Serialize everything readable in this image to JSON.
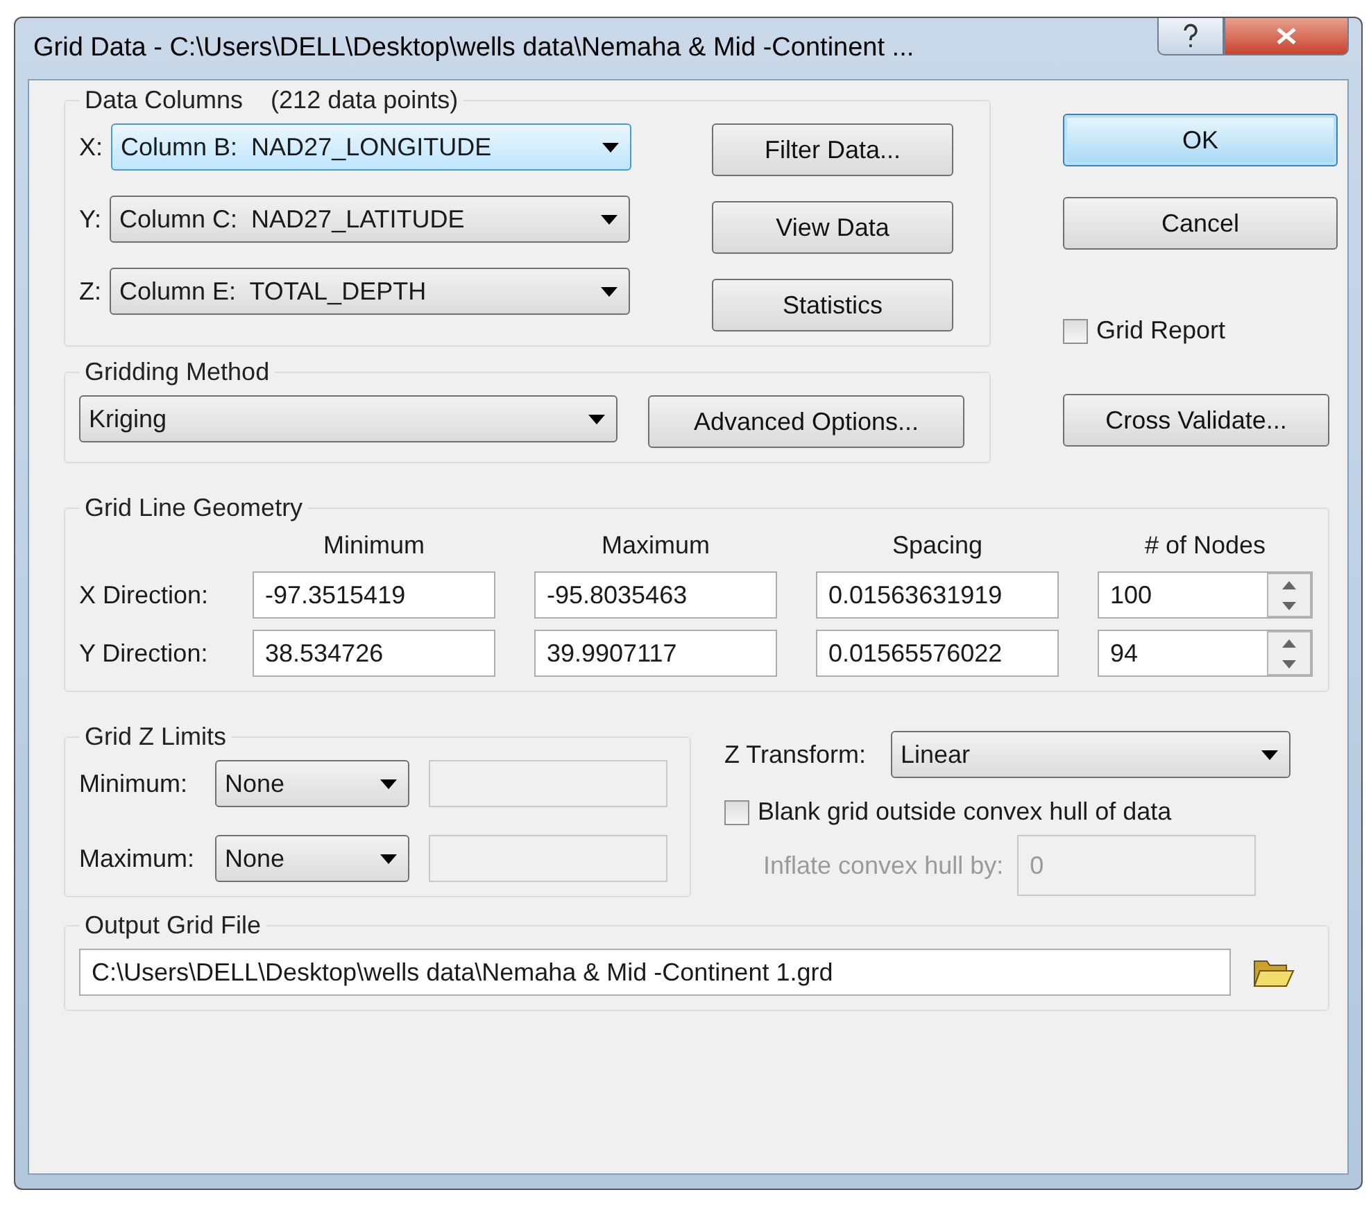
{
  "window": {
    "title": "Grid Data - C:\\Users\\DELL\\Desktop\\wells data\\Nemaha & Mid -Continent ..."
  },
  "data_columns": {
    "title": "Data Columns",
    "count": "(212 data points)",
    "rows": [
      {
        "axis": "X:",
        "value": "Column B:  NAD27_LONGITUDE",
        "focused": true
      },
      {
        "axis": "Y:",
        "value": "Column C:  NAD27_LATITUDE",
        "focused": false
      },
      {
        "axis": "Z:",
        "value": "Column E:  TOTAL_DEPTH",
        "focused": false
      }
    ],
    "buttons": [
      "Filter Data...",
      "View Data",
      "Statistics"
    ]
  },
  "dialog_buttons": [
    {
      "label": "OK",
      "default": true
    },
    {
      "label": "Cancel",
      "default": false
    }
  ],
  "grid_report": {
    "label": "Grid Report",
    "checked": false
  },
  "gridding_method": {
    "title": "Gridding Method",
    "value": "Kriging",
    "button": "Advanced Options..."
  },
  "cross_validate": "Cross Validate...",
  "geometry": {
    "title": "Grid Line Geometry",
    "headers": [
      "Minimum",
      "Maximum",
      "Spacing",
      "# of Nodes"
    ],
    "rows": [
      {
        "label": "X Direction:",
        "values": [
          "-97.3515419",
          "-95.8035463",
          "0.01563631919"
        ],
        "nodes": "100"
      },
      {
        "label": "Y Direction:",
        "values": [
          "38.534726",
          "39.9907117",
          "0.01565576022"
        ],
        "nodes": "94"
      }
    ]
  },
  "z_limits": {
    "title": "Grid Z Limits",
    "rows": [
      {
        "label": "Minimum:",
        "value": "None"
      },
      {
        "label": "Maximum:",
        "value": "None"
      }
    ]
  },
  "z_transform": {
    "label": "Z Transform:",
    "value": "Linear"
  },
  "blank_grid": {
    "label": "Blank grid outside convex hull of data",
    "checked": false
  },
  "inflate": {
    "label": "Inflate convex hull by:",
    "value": "0",
    "disabled": true
  },
  "output": {
    "title": "Output Grid File",
    "value": "C:\\Users\\DELL\\Desktop\\wells data\\Nemaha & Mid -Continent 1.grd"
  }
}
